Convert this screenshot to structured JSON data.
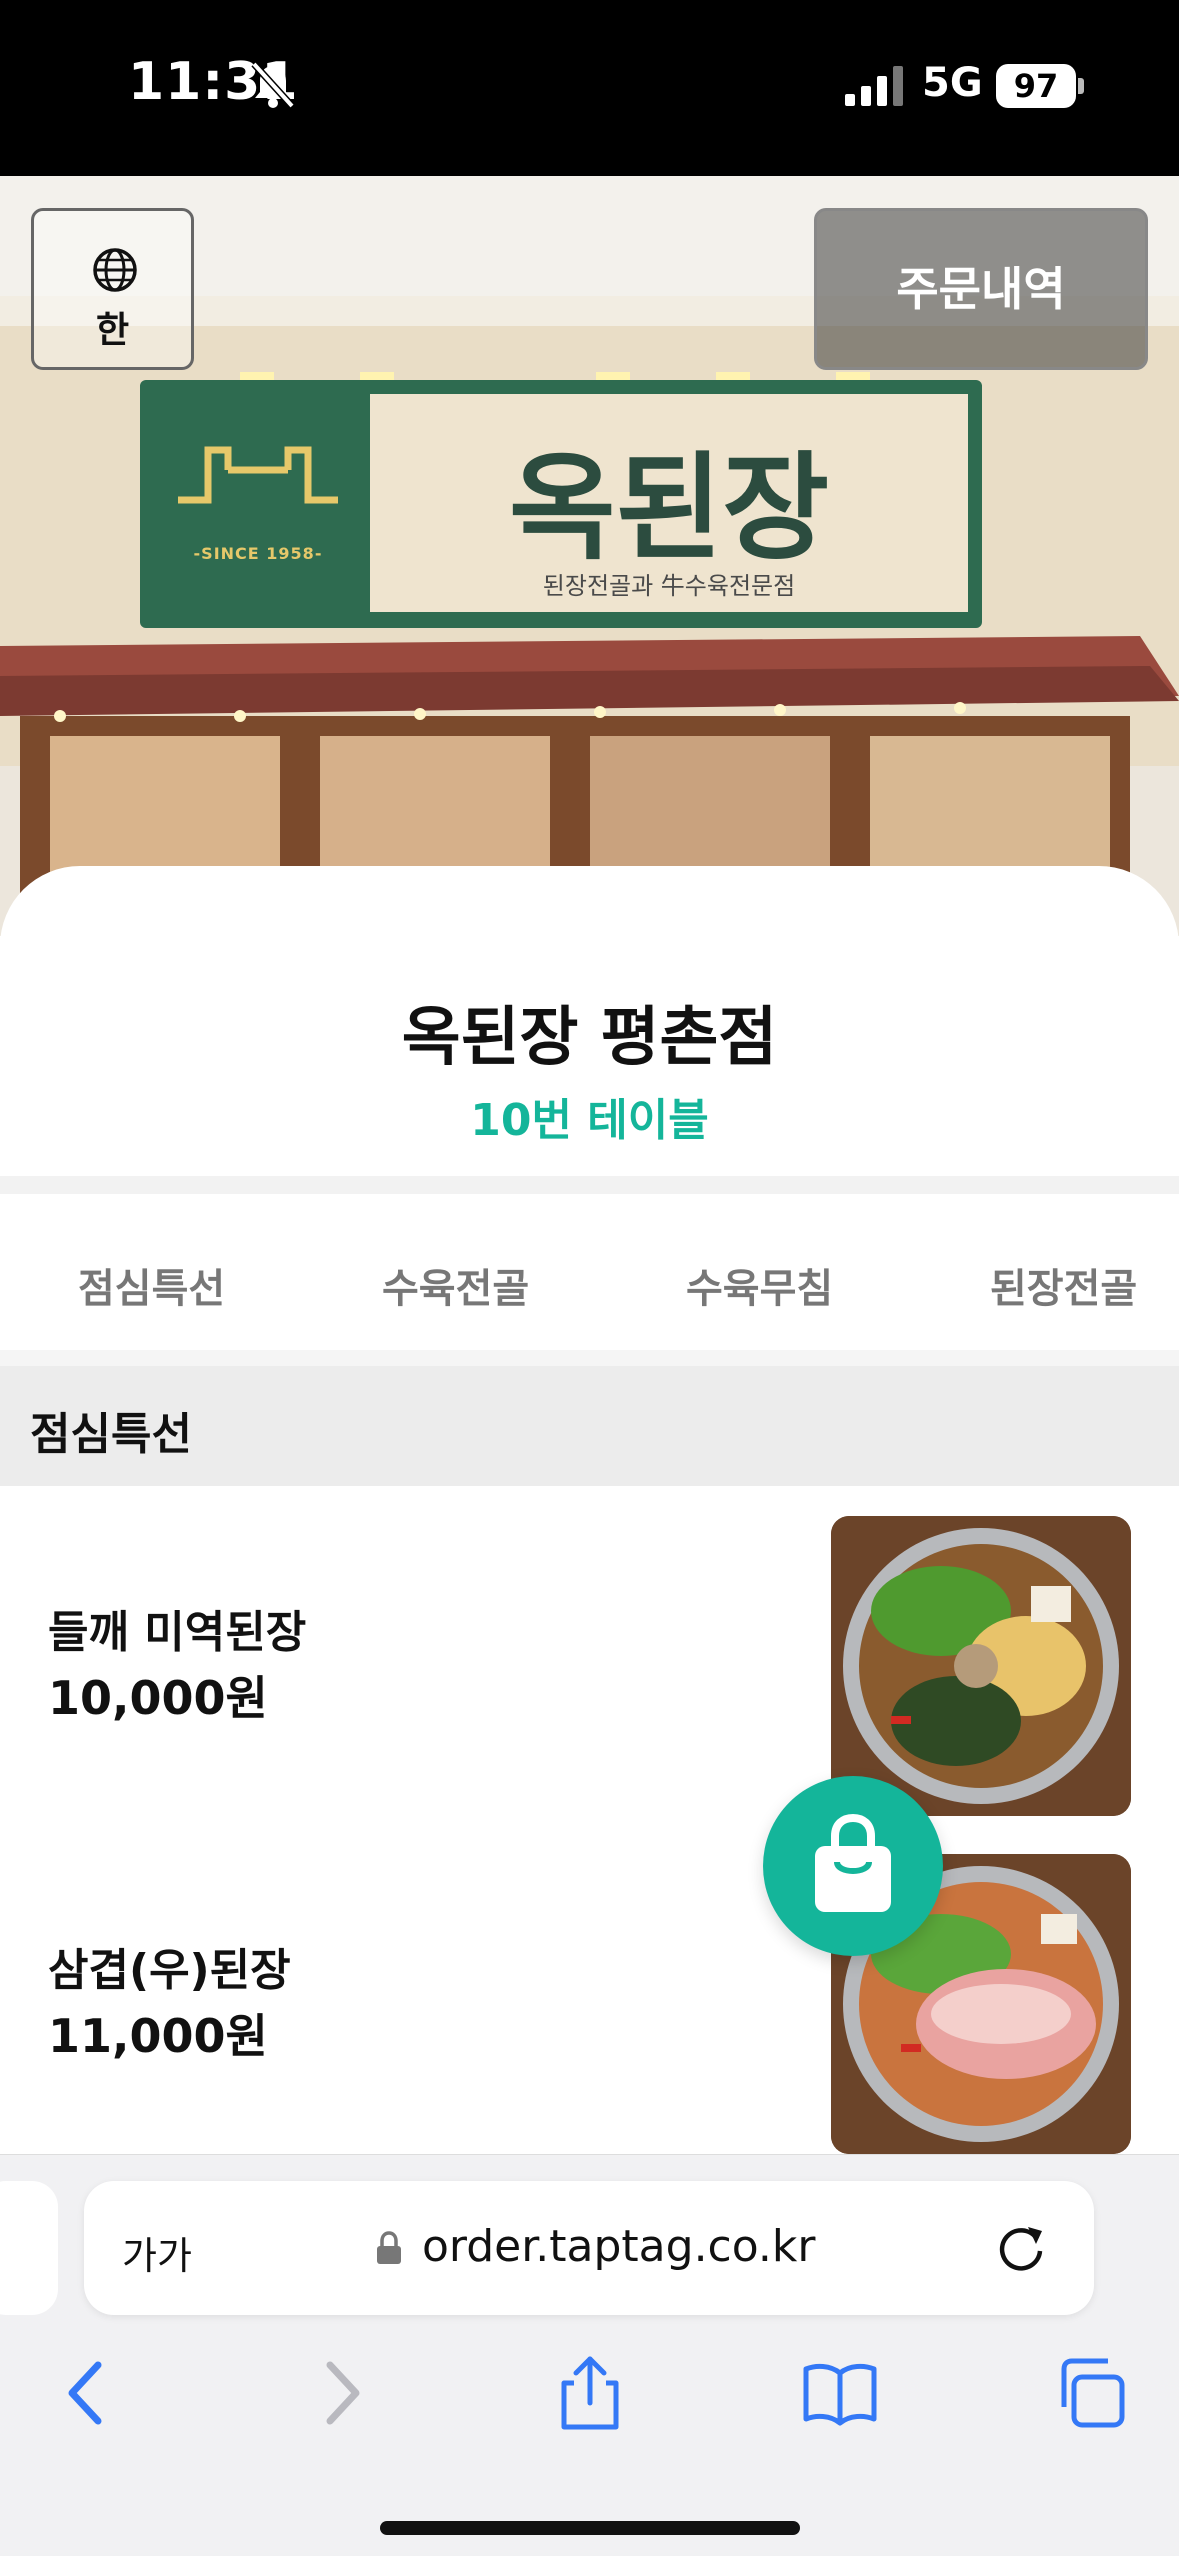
{
  "status_bar": {
    "time": "11:31",
    "network": "5G",
    "battery": "97",
    "icons": [
      "bell-slash-icon",
      "signal-icon",
      "battery-icon"
    ]
  },
  "hero": {
    "language_button": "한",
    "orders_button": "주문내역",
    "sign_title": "옥된장",
    "sign_subtitle": "된장전골과 牛수육전문점",
    "sign_since": "-SINCE 1958-"
  },
  "store": {
    "name": "옥된장 평촌점",
    "table": "10번 테이블"
  },
  "category_tabs": [
    "점심특선",
    "수육전골",
    "수육무침",
    "된장전골"
  ],
  "section": {
    "title": "점심특선"
  },
  "menu_items": [
    {
      "name": "들깨 미역된장",
      "price": "10,000원"
    },
    {
      "name": "삼겹(우)된장",
      "price": "11,000원"
    }
  ],
  "browser": {
    "text_size_button": "가가",
    "url": "order.taptag.co.kr",
    "toolbar_icons": [
      "back-icon",
      "forward-icon",
      "share-icon",
      "bookmarks-icon",
      "tabs-icon"
    ]
  },
  "colors": {
    "accent": "#14b59a",
    "sign_green": "#2e6b50",
    "safari_blue": "#3478f6"
  }
}
